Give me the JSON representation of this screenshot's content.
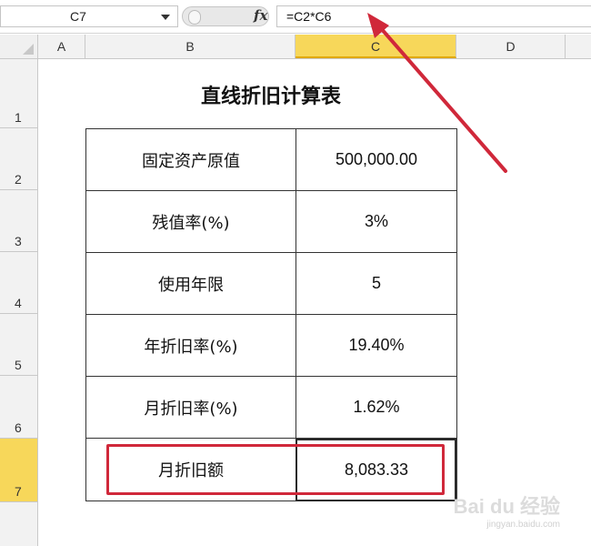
{
  "formula_bar": {
    "name_box": "C7",
    "fx_symbol": "fx",
    "formula": "=C2*C6"
  },
  "columns": [
    "A",
    "B",
    "C",
    "D"
  ],
  "active_column": "C",
  "rows": [
    "1",
    "2",
    "3",
    "4",
    "5",
    "6",
    "7"
  ],
  "active_row": "7",
  "sheet": {
    "title": "直线折旧计算表",
    "table": [
      {
        "label": "固定资产原值",
        "value": "500,000.00"
      },
      {
        "label": "残值率(%)",
        "value": "3%"
      },
      {
        "label": "使用年限",
        "value": "5"
      },
      {
        "label": "年折旧率(%)",
        "value": "19.40%"
      },
      {
        "label": "月折旧率(%)",
        "value": "1.62%"
      },
      {
        "label": "月折旧额",
        "value": "8,083.33"
      }
    ]
  },
  "annotation": {
    "color": "#d0283a"
  },
  "watermark": {
    "logo": "Bai du 经验",
    "url": "jingyan.baidu.com"
  }
}
